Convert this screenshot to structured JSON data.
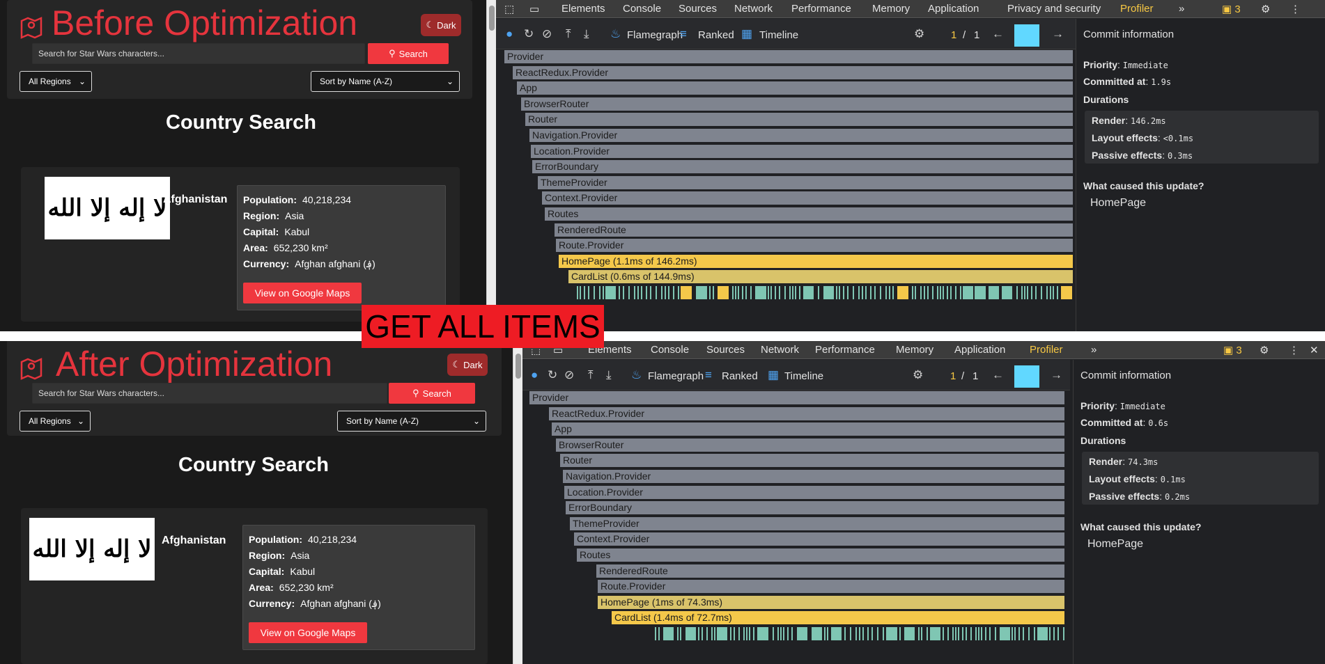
{
  "banner": "GET ALL ITEMS",
  "app": {
    "search_placeholder": "Search for Star Wars characters...",
    "search_label": "Search",
    "dark_label": "Dark",
    "regions_label": "All Regions",
    "sort_label": "Sort by Name (A-Z)",
    "page_title": "Country Search",
    "country": {
      "name": "Afghanistan",
      "flag_text": "لا إله إلا الله",
      "fields": [
        {
          "label": "Population:",
          "value": "40,218,234"
        },
        {
          "label": "Region:",
          "value": "Asia"
        },
        {
          "label": "Capital:",
          "value": "Kabul"
        },
        {
          "label": "Area:",
          "value": "652,230 km²"
        },
        {
          "label": "Currency:",
          "value": "Afghan afghani (؋)"
        }
      ],
      "maps_label": "View on Google Maps"
    }
  },
  "before": {
    "title": "Before Optimization",
    "devtools": {
      "tabs": [
        "Elements",
        "Console",
        "Sources",
        "Network",
        "Performance",
        "Memory",
        "Application",
        "Privacy and security",
        "Profiler"
      ],
      "issues_count": "3",
      "toolbar": {
        "flamegraph": "Flamegraph",
        "ranked": "Ranked",
        "timeline": "Timeline",
        "page_current": "1",
        "page_sep": "/",
        "page_total": "1"
      },
      "commit": {
        "title": "Commit information",
        "priority_label": "Priority",
        "priority": "Immediate",
        "committed_label": "Committed at",
        "committed": "1.9s",
        "durations_label": "Durations",
        "render_label": "Render",
        "render": "146.2ms",
        "layout_label": "Layout effects",
        "layout": "<0.1ms",
        "passive_label": "Passive effects",
        "passive": "0.3ms",
        "cause_label": "What caused this update?",
        "cause": "HomePage"
      },
      "flame": [
        {
          "label": "Provider",
          "depth": 0,
          "kind": "normal"
        },
        {
          "label": "ReactRedux.Provider",
          "depth": 1,
          "kind": "normal"
        },
        {
          "label": "App",
          "depth": 2,
          "kind": "normal"
        },
        {
          "label": "BrowserRouter",
          "depth": 3,
          "kind": "normal"
        },
        {
          "label": "Router",
          "depth": 4,
          "kind": "normal"
        },
        {
          "label": "Navigation.Provider",
          "depth": 5,
          "kind": "normal"
        },
        {
          "label": "Location.Provider",
          "depth": 6,
          "kind": "normal"
        },
        {
          "label": "ErrorBoundary",
          "depth": 7,
          "kind": "normal"
        },
        {
          "label": "ThemeProvider",
          "depth": 8,
          "kind": "normal"
        },
        {
          "label": "Context.Provider",
          "depth": 9,
          "kind": "normal"
        },
        {
          "label": "Routes",
          "depth": 10,
          "kind": "normal"
        },
        {
          "label": "RenderedRoute",
          "depth": 11,
          "kind": "normal"
        },
        {
          "label": "Route.Provider",
          "depth": 12,
          "kind": "normal"
        },
        {
          "label": "HomePage (1.1ms of 146.2ms)",
          "depth": 13,
          "kind": "hot"
        },
        {
          "label": "CardList (0.6ms of 144.9ms)",
          "depth": 14,
          "kind": "warm"
        }
      ]
    }
  },
  "after": {
    "title": "After Optimization",
    "devtools": {
      "tabs": [
        "Elements",
        "Console",
        "Sources",
        "Network",
        "Performance",
        "Memory",
        "Application",
        "Profiler"
      ],
      "issues_count": "3",
      "toolbar": {
        "flamegraph": "Flamegraph",
        "ranked": "Ranked",
        "timeline": "Timeline",
        "page_current": "1",
        "page_sep": "/",
        "page_total": "1"
      },
      "commit": {
        "title": "Commit information",
        "priority_label": "Priority",
        "priority": "Immediate",
        "committed_label": "Committed at",
        "committed": "0.6s",
        "durations_label": "Durations",
        "render_label": "Render",
        "render": "74.3ms",
        "layout_label": "Layout effects",
        "layout": "0.1ms",
        "passive_label": "Passive effects",
        "passive": "0.2ms",
        "cause_label": "What caused this update?",
        "cause": "HomePage"
      },
      "flame": [
        {
          "label": "Provider",
          "depth": 0,
          "kind": "normal"
        },
        {
          "label": "ReactRedux.Provider",
          "depth": 1,
          "kind": "normal"
        },
        {
          "label": "App",
          "depth": 2,
          "kind": "normal"
        },
        {
          "label": "BrowserRouter",
          "depth": 3,
          "kind": "normal"
        },
        {
          "label": "Router",
          "depth": 4,
          "kind": "normal"
        },
        {
          "label": "Navigation.Provider",
          "depth": 5,
          "kind": "normal"
        },
        {
          "label": "Location.Provider",
          "depth": 6,
          "kind": "normal"
        },
        {
          "label": "ErrorBoundary",
          "depth": 7,
          "kind": "normal"
        },
        {
          "label": "ThemeProvider",
          "depth": 8,
          "kind": "normal"
        },
        {
          "label": "Context.Provider",
          "depth": 9,
          "kind": "normal"
        },
        {
          "label": "Routes",
          "depth": 10,
          "kind": "normal"
        },
        {
          "label": "RenderedRoute",
          "depth": 11,
          "kind": "normal"
        },
        {
          "label": "Route.Provider",
          "depth": 12,
          "kind": "normal"
        },
        {
          "label": "HomePage (1ms of 74.3ms)",
          "depth": 13,
          "kind": "warm"
        },
        {
          "label": "CardList (1.4ms of 72.7ms)",
          "depth": 14,
          "kind": "hot"
        }
      ]
    }
  },
  "colors": {
    "accent_red": "#f0383f",
    "title_red": "#e5343d",
    "profiler_yellow": "#f7c843",
    "bar_gray": "#7f848f",
    "bar_hot": "#f4c84a",
    "tick_teal": "#7fc6b3"
  }
}
